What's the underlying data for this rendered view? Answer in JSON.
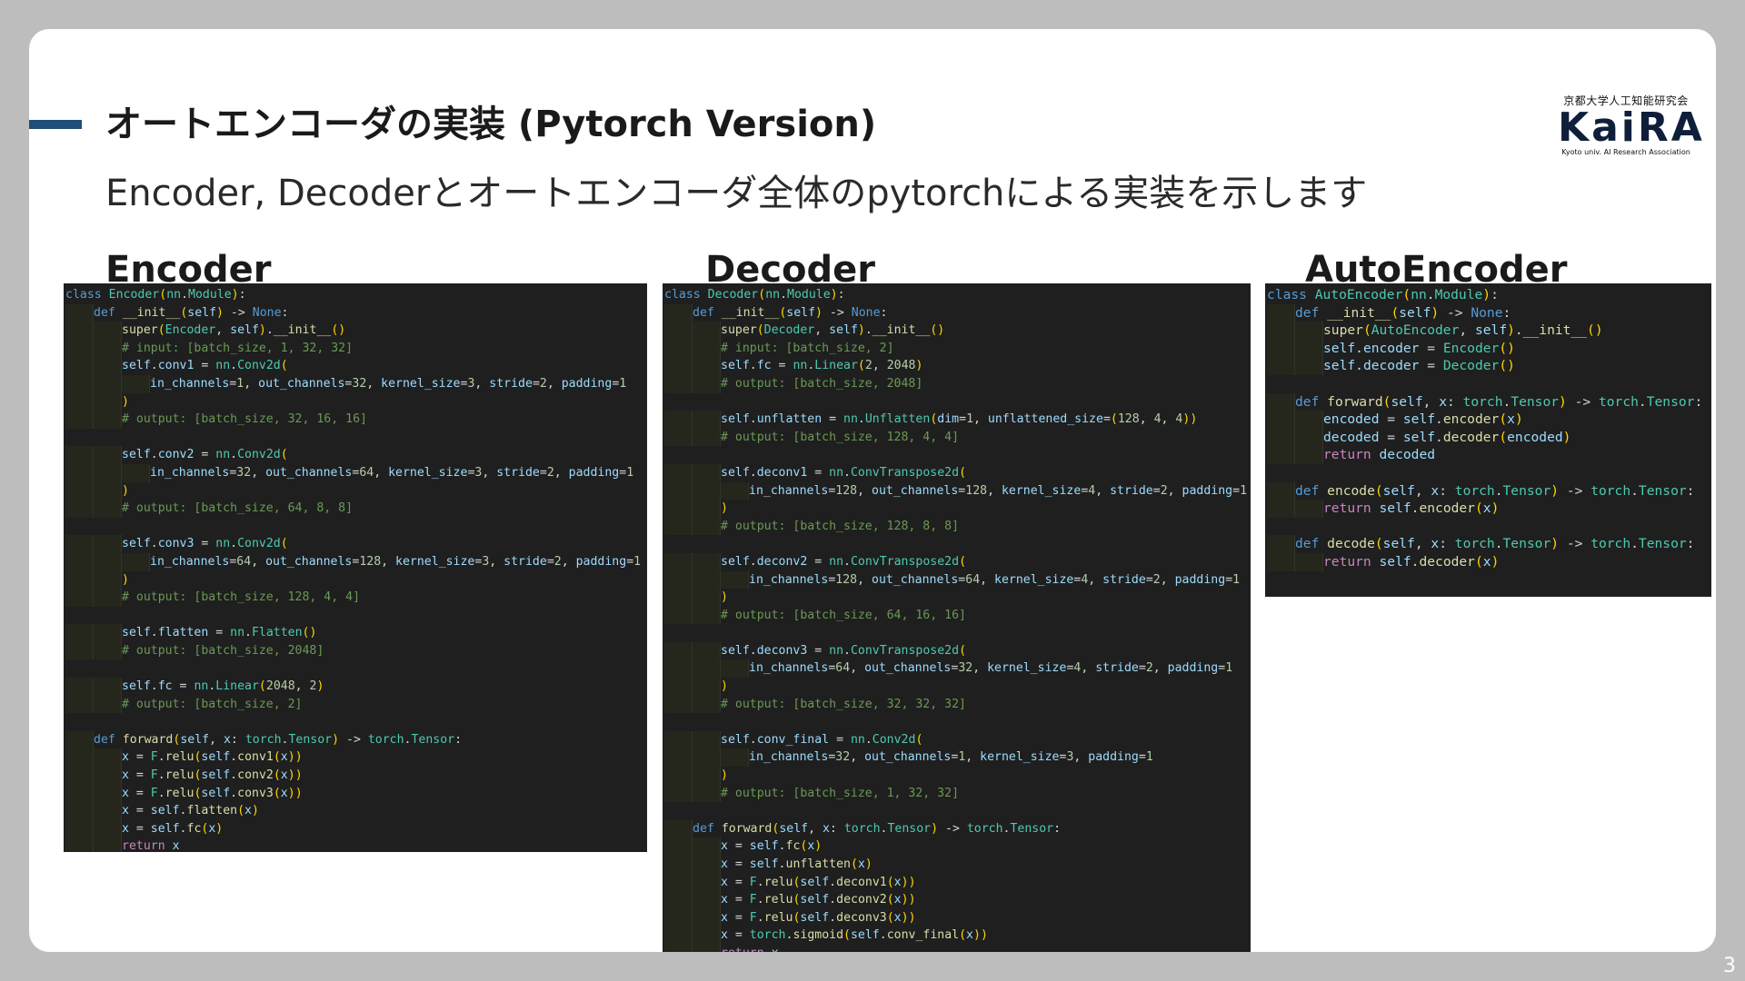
{
  "slide": {
    "title": "オートエンコーダの実装 (Pytorch Version)",
    "subtitle": "Encoder, Decoderとオートエンコーダ全体のpytorchによる実装を示します",
    "page_number": "3",
    "logo": {
      "japanese": "京都大学人工知能研究会",
      "main": "KaiRA",
      "english": "Kyoto univ. AI Research Association"
    }
  },
  "sections": {
    "encoder": {
      "title": "Encoder"
    },
    "decoder": {
      "title": "Decoder"
    },
    "autoencoder": {
      "title": "AutoEncoder"
    }
  },
  "code": {
    "encoder": [
      "class Encoder(nn.Module):",
      "    def __init__(self) -> None:",
      "        super(Encoder, self).__init__()",
      "        # input: [batch_size, 1, 32, 32]",
      "        self.conv1 = nn.Conv2d(",
      "            in_channels=1, out_channels=32, kernel_size=3, stride=2, padding=1",
      "        )",
      "        # output: [batch_size, 32, 16, 16]",
      "",
      "        self.conv2 = nn.Conv2d(",
      "            in_channels=32, out_channels=64, kernel_size=3, stride=2, padding=1",
      "        )",
      "        # output: [batch_size, 64, 8, 8]",
      "",
      "        self.conv3 = nn.Conv2d(",
      "            in_channels=64, out_channels=128, kernel_size=3, stride=2, padding=1",
      "        )",
      "        # output: [batch_size, 128, 4, 4]",
      "",
      "        self.flatten = nn.Flatten()",
      "        # output: [batch_size, 2048]",
      "",
      "        self.fc = nn.Linear(2048, 2)",
      "        # output: [batch_size, 2]",
      "",
      "    def forward(self, x: torch.Tensor) -> torch.Tensor:",
      "        x = F.relu(self.conv1(x))",
      "        x = F.relu(self.conv2(x))",
      "        x = F.relu(self.conv3(x))",
      "        x = self.flatten(x)",
      "        x = self.fc(x)",
      "        return x"
    ],
    "decoder": [
      "class Decoder(nn.Module):",
      "    def __init__(self) -> None:",
      "        super(Decoder, self).__init__()",
      "        # input: [batch_size, 2]",
      "        self.fc = nn.Linear(2, 2048)",
      "        # output: [batch_size, 2048]",
      "",
      "        self.unflatten = nn.Unflatten(dim=1, unflattened_size=(128, 4, 4))",
      "        # output: [batch_size, 128, 4, 4]",
      "",
      "        self.deconv1 = nn.ConvTranspose2d(",
      "            in_channels=128, out_channels=128, kernel_size=4, stride=2, padding=1",
      "        )",
      "        # output: [batch_size, 128, 8, 8]",
      "",
      "        self.deconv2 = nn.ConvTranspose2d(",
      "            in_channels=128, out_channels=64, kernel_size=4, stride=2, padding=1",
      "        )",
      "        # output: [batch_size, 64, 16, 16]",
      "",
      "        self.deconv3 = nn.ConvTranspose2d(",
      "            in_channels=64, out_channels=32, kernel_size=4, stride=2, padding=1",
      "        )",
      "        # output: [batch_size, 32, 32, 32]",
      "",
      "        self.conv_final = nn.Conv2d(",
      "            in_channels=32, out_channels=1, kernel_size=3, padding=1",
      "        )",
      "        # output: [batch_size, 1, 32, 32]",
      "",
      "    def forward(self, x: torch.Tensor) -> torch.Tensor:",
      "        x = self.fc(x)",
      "        x = self.unflatten(x)",
      "        x = F.relu(self.deconv1(x))",
      "        x = F.relu(self.deconv2(x))",
      "        x = F.relu(self.deconv3(x))",
      "        x = torch.sigmoid(self.conv_final(x))",
      "        return x"
    ],
    "autoencoder": [
      "class AutoEncoder(nn.Module):",
      "    def __init__(self) -> None:",
      "        super(AutoEncoder, self).__init__()",
      "        self.encoder = Encoder()",
      "        self.decoder = Decoder()",
      "",
      "    def forward(self, x: torch.Tensor) -> torch.Tensor:",
      "        encoded = self.encoder(x)",
      "        decoded = self.decoder(encoded)",
      "        return decoded",
      "",
      "    def encode(self, x: torch.Tensor) -> torch.Tensor:",
      "        return self.encoder(x)",
      "",
      "    def decode(self, x: torch.Tensor) -> torch.Tensor:",
      "        return self.decoder(x)"
    ]
  },
  "colors": {
    "slide_background": "#ffffff",
    "frame": "#bdbdbd",
    "accent": "#1e4f7a",
    "code_background": "#1f1f1f"
  }
}
